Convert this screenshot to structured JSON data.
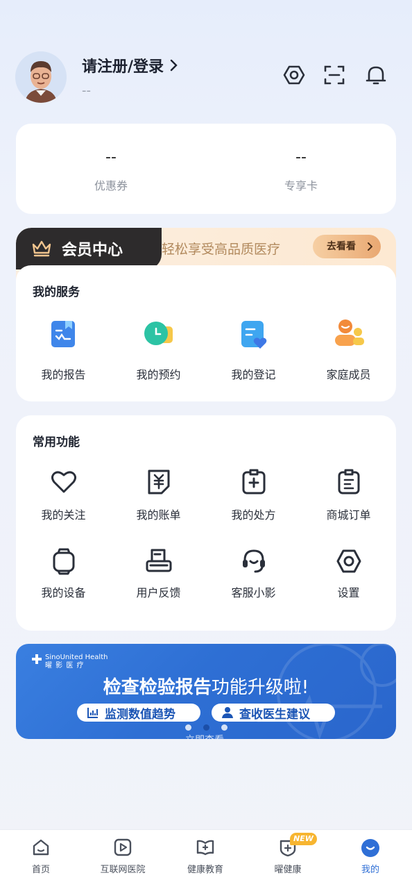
{
  "header": {
    "login_title": "请注册/登录",
    "login_sub": "--"
  },
  "stats": [
    {
      "value": "--",
      "label": "优惠券"
    },
    {
      "value": "--",
      "label": "专享卡"
    }
  ],
  "member": {
    "title": "会员中心",
    "slogan": "轻松享受高品质医疗",
    "button": "去看看"
  },
  "services": {
    "title": "我的服务",
    "items": [
      {
        "label": "我的报告",
        "icon": "report-icon"
      },
      {
        "label": "我的预约",
        "icon": "appointment-icon"
      },
      {
        "label": "我的登记",
        "icon": "registration-icon"
      },
      {
        "label": "家庭成员",
        "icon": "family-icon"
      }
    ]
  },
  "common": {
    "title": "常用功能",
    "items": [
      {
        "label": "我的关注",
        "icon": "heart-icon"
      },
      {
        "label": "我的账单",
        "icon": "bill-icon"
      },
      {
        "label": "我的处方",
        "icon": "prescription-icon"
      },
      {
        "label": "商城订单",
        "icon": "order-icon"
      },
      {
        "label": "我的设备",
        "icon": "watch-icon"
      },
      {
        "label": "用户反馈",
        "icon": "feedback-icon"
      },
      {
        "label": "客服小影",
        "icon": "headset-icon"
      },
      {
        "label": "设置",
        "icon": "settings-icon"
      }
    ]
  },
  "promo": {
    "logo_en": "SinoUnited Health",
    "logo_cn": "曜 影 医 疗",
    "title_bold": "检查检验报告",
    "title_rest": "功能升级啦!",
    "pill1": "监测数值趋势",
    "pill2": "查收医生建议",
    "more": "立即查看"
  },
  "nav": {
    "items": [
      {
        "label": "首页",
        "icon": "home-icon"
      },
      {
        "label": "互联网医院",
        "icon": "hospital-icon"
      },
      {
        "label": "健康教育",
        "icon": "education-icon"
      },
      {
        "label": "曜健康",
        "icon": "health-icon"
      },
      {
        "label": "我的",
        "icon": "profile-icon"
      }
    ],
    "badge": "NEW"
  },
  "colors": {
    "accent": "#2f6fd6",
    "member_dark": "#2d2b2c",
    "member_gold": "#b28a5e",
    "badge": "#f7b530"
  }
}
